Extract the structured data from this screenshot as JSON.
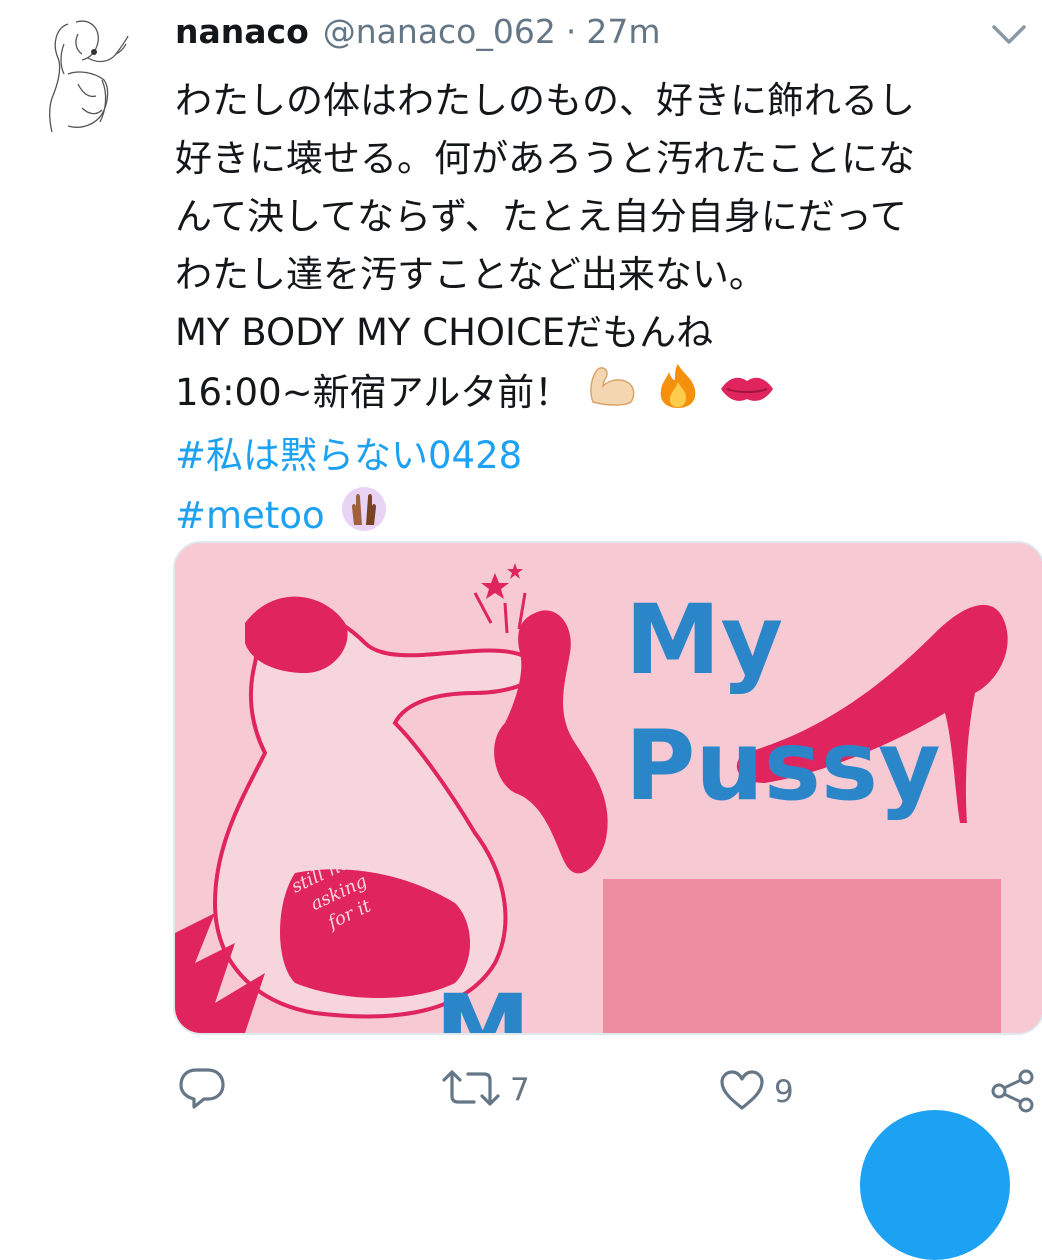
{
  "tweet": {
    "name": "nanaco",
    "handle": "@nanaco_062",
    "separator": "·",
    "time": "27m",
    "lines": [
      "わたしの体はわたしのもの、好きに飾れるし",
      "好きに壊せる。何があろうと汚れたことにな",
      "んて決してならず、たとえ自分自身にだって",
      "わたし達を汚すことなど出来ない。",
      "MY BODY MY CHOICEだもんね"
    ],
    "event_line": "16:00~新宿アルタ前！",
    "hashtag1": "#私は黙らない0428",
    "hashtag2": "#metoo",
    "emoji_icons": [
      "flexed-biceps-icon",
      "fire-icon",
      "kiss-mark-icon",
      "raised-hands-icon"
    ]
  },
  "media": {
    "title_line1": "My",
    "title_line2": "Pussy",
    "bottom_letter": "M",
    "back_text": [
      "still not",
      "asking",
      "for it"
    ],
    "colors": {
      "background": "#f6c9d3",
      "ink": "#e0245e",
      "title": "#2a86c8"
    }
  },
  "actions": {
    "reply_icon": "reply-icon",
    "retweet_icon": "retweet-icon",
    "retweet_count": "7",
    "like_icon": "heart-icon",
    "like_count": "9",
    "share_icon": "share-icon"
  },
  "colors": {
    "accent": "#1da1f2",
    "muted": "#657786",
    "text": "#14171a"
  }
}
